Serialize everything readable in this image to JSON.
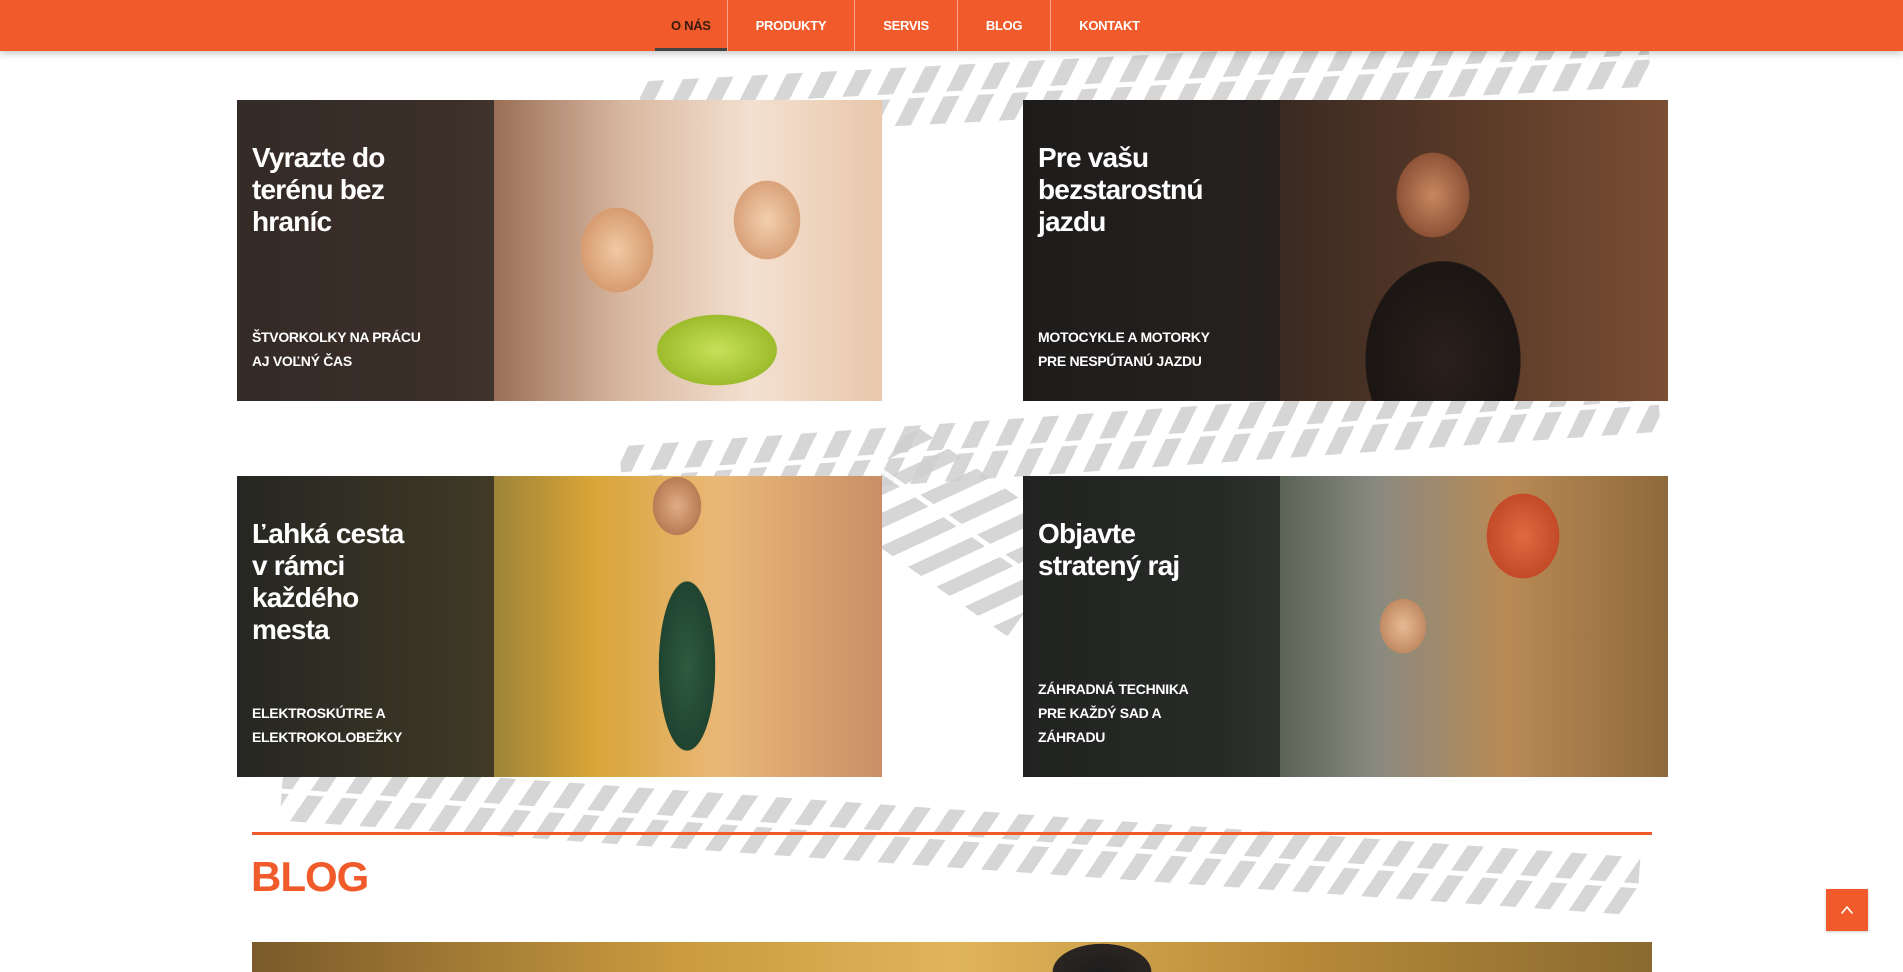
{
  "nav": {
    "items": [
      {
        "label": "O NÁS",
        "active": true
      },
      {
        "label": "PRODUKTY",
        "active": false
      },
      {
        "label": "SERVIS",
        "active": false
      },
      {
        "label": "BLOG",
        "active": false
      },
      {
        "label": "KONTAKT",
        "active": false
      }
    ]
  },
  "cards": [
    {
      "title": "Vyrazte do\nterénu bez\nhraníc",
      "subtitle": "ŠTVORKOLKY NA PRÁCU\nAJ VOĽNÝ ČAS"
    },
    {
      "title": "Pre vašu\nbezstarostnú\njazdu",
      "subtitle": "MOTOCYKLE A MOTORKY\nPRE NESPÚTANÚ JAZDU"
    },
    {
      "title": "Ľahká cesta\nv rámci\nkaždého\nmesta",
      "subtitle": "ELEKTROSKÚTRE A\nELEKTROKOLOBEŽKY"
    },
    {
      "title": "Objavte\nstratený raj",
      "subtitle": "ZÁHRADNÁ TECHNIKA\nPRE KAŽDÝ SAD A\nZÁHRADU"
    }
  ],
  "blog": {
    "title": "BLOG"
  },
  "back_to_top": {
    "icon": "chevron-up-icon"
  },
  "colors": {
    "accent": "#f15a2a",
    "overlay": "#1e1e1e",
    "track": "#cfcfcf"
  }
}
